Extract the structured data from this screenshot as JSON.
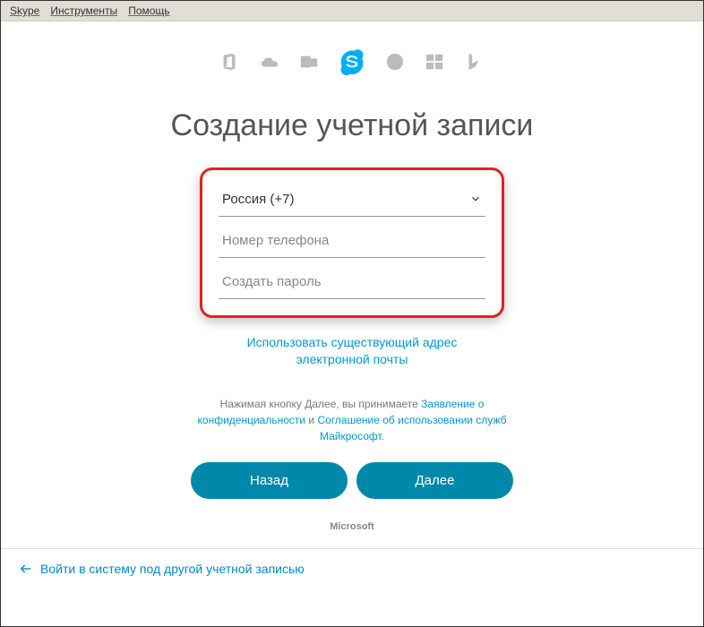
{
  "menu": {
    "skype": "Skype",
    "tools": "Инструменты",
    "help": "Помощь"
  },
  "title": "Создание учетной записи",
  "form": {
    "country": "Россия (+7)",
    "phone_placeholder": "Номер телефона",
    "password_placeholder": "Создать пароль"
  },
  "email_link": "Использовать существующий адрес электронной почты",
  "terms": {
    "prefix": "Нажимая кнопку Далее, вы принимаете ",
    "privacy": "Заявление о конфиденциальности",
    "and": " и ",
    "tos": "Соглашение об использовании служб Майкрософт",
    "suffix": "."
  },
  "buttons": {
    "back": "Назад",
    "next": "Далее"
  },
  "brand": "Microsoft",
  "footer_link": "Войти в систему под другой учетной записью"
}
